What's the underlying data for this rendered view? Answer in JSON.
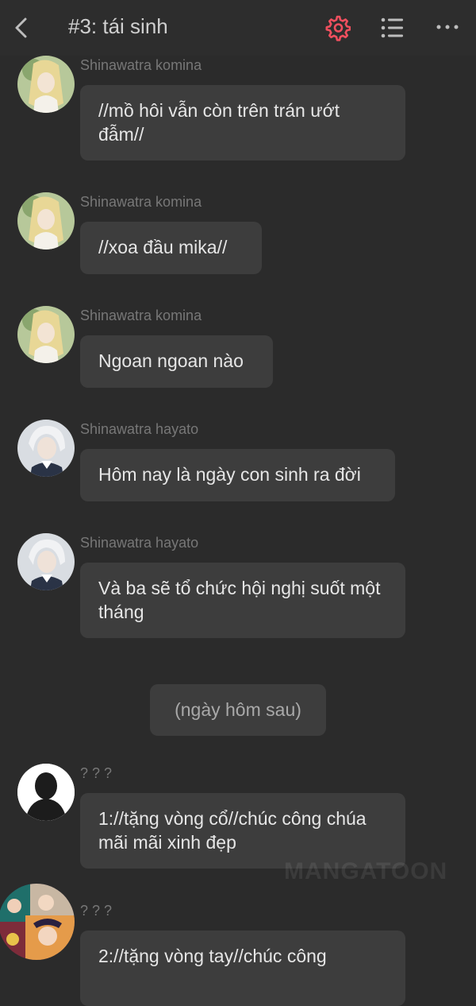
{
  "header": {
    "title": "#3: tái sinh",
    "icons": {
      "back": "back-arrow-icon",
      "settings": "gear-icon",
      "list": "list-icon",
      "more": "more-dots-icon"
    },
    "accent_color": "#ef4f5e"
  },
  "messages": [
    {
      "sender": "Shinawatra komina",
      "text": "//mồ hôi vẫn còn trên trán ướt đẫm//",
      "avatar": "blonde-girl"
    },
    {
      "sender": "Shinawatra komina",
      "text": "//xoa đầu mika//",
      "avatar": "blonde-girl"
    },
    {
      "sender": "Shinawatra komina",
      "text": "Ngoan ngoan nào",
      "avatar": "blonde-girl"
    },
    {
      "sender": "Shinawatra hayato",
      "text": "Hôm nay là ngày con sinh ra đời",
      "avatar": "white-hair-man"
    },
    {
      "sender": "Shinawatra hayato",
      "text": "Và ba sẽ tổ chức hội nghị suốt một tháng",
      "avatar": "white-hair-man"
    },
    {
      "sender": "? ? ?",
      "text": "1://tặng vòng cổ//chúc công chúa mãi mãi xinh đẹp",
      "avatar": "silhouette"
    },
    {
      "sender": "? ? ?",
      "text": "2://tặng vòng tay//chúc công",
      "avatar": "colorful-collage"
    }
  ],
  "narration": "(ngày hôm sau)",
  "watermark": "MANGATOON"
}
